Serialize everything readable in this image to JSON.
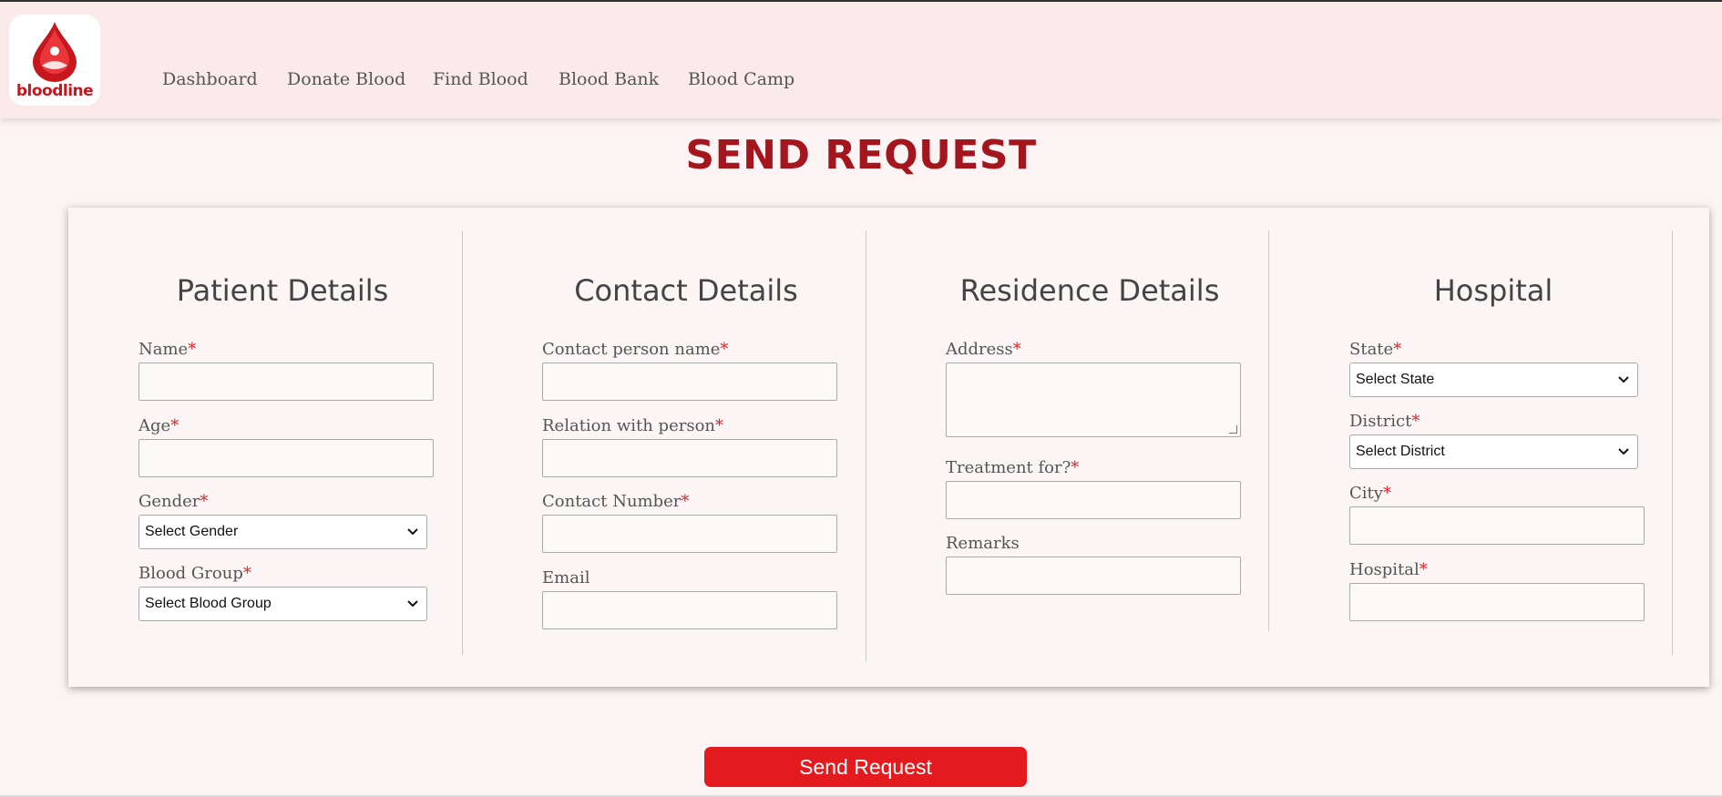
{
  "brand": {
    "logo_text": "bloodline",
    "accent": "#a4161d",
    "button_color": "#e31b1f"
  },
  "nav": {
    "items": [
      {
        "label": "Dashboard"
      },
      {
        "label": "Donate Blood"
      },
      {
        "label": "Find Blood"
      },
      {
        "label": "Blood Bank"
      },
      {
        "label": "Blood Camp"
      }
    ]
  },
  "page_title": "SEND REQUEST",
  "required_mark": "*",
  "patient": {
    "title": "Patient Details",
    "name_label": "Name",
    "name_value": "",
    "age_label": "Age",
    "age_value": "",
    "gender_label": "Gender",
    "gender_selected": "Select Gender",
    "blood_group_label": "Blood Group",
    "blood_group_selected": "Select Blood Group"
  },
  "contact": {
    "title": "Contact Details",
    "person_label": "Contact person name",
    "relation_label": "Relation with person",
    "number_label": "Contact Number",
    "email_label": "Email"
  },
  "residence": {
    "title": "Residence Details",
    "address_label": "Address",
    "treatment_label": "Treatment for?",
    "remarks_label": "Remarks"
  },
  "hospital": {
    "title": "Hospital",
    "state_label": "State",
    "state_selected": "Select State",
    "district_label": "District",
    "district_selected": "Select District",
    "city_label": "City",
    "hospital_label": "Hospital"
  },
  "submit_label": "Send Request"
}
